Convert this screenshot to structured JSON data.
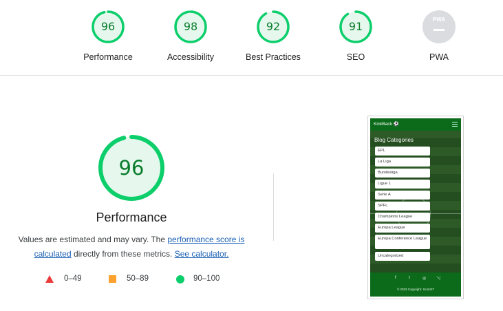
{
  "categories": [
    {
      "score": "96",
      "label": "Performance",
      "fraction": 0.96
    },
    {
      "score": "98",
      "label": "Accessibility",
      "fraction": 0.98
    },
    {
      "score": "92",
      "label": "Best Practices",
      "fraction": 0.92
    },
    {
      "score": "91",
      "label": "SEO",
      "fraction": 0.91
    }
  ],
  "pwa": {
    "badge_text": "PWA",
    "label": "PWA"
  },
  "performance": {
    "score": "96",
    "fraction": 0.96,
    "title": "Performance",
    "desc_prefix": "Values are estimated and may vary. The ",
    "desc_link1": "performance score is calculated",
    "desc_middle": " directly from these metrics. ",
    "desc_link2": "See calculator."
  },
  "legend": {
    "fail": "0–49",
    "average": "50–89",
    "pass": "90–100"
  },
  "colors": {
    "pass": "#0cce6b",
    "pass_text": "#0a7d2c",
    "average": "#ffa12e",
    "fail": "#eb3b3b",
    "pwa_gray": "#dadce0"
  },
  "phone": {
    "brand": "KickBack ⚽",
    "heading": "Blog Categories",
    "items": [
      "EPL",
      "La Liga",
      "Bundesliga",
      "Ligue 1",
      "Serie A",
      "SPFL",
      "Champions League",
      "Europa League",
      "Europa Conference League",
      "Uncategorized"
    ],
    "social": [
      "f",
      "t",
      "◎",
      "⌥"
    ],
    "copyright": "© 2023 Copyright: Scot427"
  }
}
